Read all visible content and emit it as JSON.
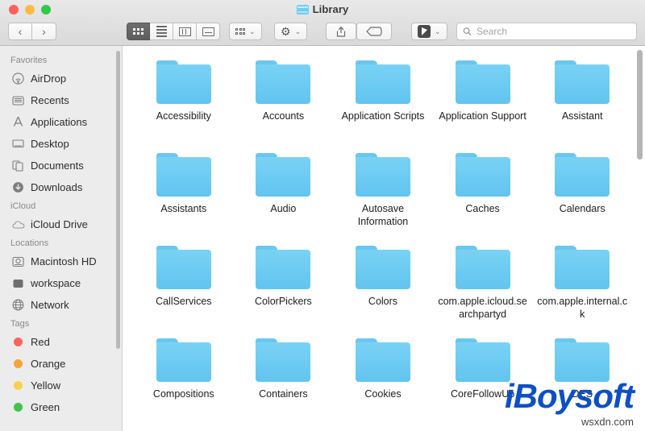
{
  "window": {
    "title": "Library",
    "traffic_lights": [
      {
        "name": "close",
        "color": "#fc615d"
      },
      {
        "name": "minimize",
        "color": "#fdbc40"
      },
      {
        "name": "maximize",
        "color": "#34c749"
      }
    ]
  },
  "toolbar": {
    "back_label": "‹",
    "forward_label": "›",
    "view_modes": [
      {
        "name": "icon-view",
        "active": true
      },
      {
        "name": "list-view",
        "active": false
      },
      {
        "name": "column-view",
        "active": false
      },
      {
        "name": "gallery-view",
        "active": false
      }
    ],
    "group_by_label": "",
    "action_label": "⚙",
    "share_label": "⇧",
    "tag_label": "▭",
    "chevron": "⌄"
  },
  "search": {
    "placeholder": "Search",
    "value": "",
    "icon": "search-icon"
  },
  "sidebar": {
    "sections": [
      {
        "header": "Favorites",
        "items": [
          {
            "label": "AirDrop",
            "icon": "airdrop-icon"
          },
          {
            "label": "Recents",
            "icon": "recents-icon"
          },
          {
            "label": "Applications",
            "icon": "applications-icon"
          },
          {
            "label": "Desktop",
            "icon": "desktop-icon"
          },
          {
            "label": "Documents",
            "icon": "documents-icon"
          },
          {
            "label": "Downloads",
            "icon": "downloads-icon"
          }
        ]
      },
      {
        "header": "iCloud",
        "items": [
          {
            "label": "iCloud Drive",
            "icon": "cloud-icon"
          }
        ]
      },
      {
        "header": "Locations",
        "items": [
          {
            "label": "Macintosh HD",
            "icon": "harddisk-icon"
          },
          {
            "label": "workspace",
            "icon": "volume-icon"
          },
          {
            "label": "Network",
            "icon": "globe-icon"
          }
        ]
      },
      {
        "header": "Tags",
        "items": [
          {
            "label": "Red",
            "icon": "tag-dot-icon",
            "color": "#f9655d"
          },
          {
            "label": "Orange",
            "icon": "tag-dot-icon",
            "color": "#f6a33a"
          },
          {
            "label": "Yellow",
            "icon": "tag-dot-icon",
            "color": "#f8d14c"
          },
          {
            "label": "Green",
            "icon": "tag-dot-icon",
            "color": "#3fc34a"
          }
        ]
      }
    ]
  },
  "content": {
    "items": [
      {
        "label": "Accessibility"
      },
      {
        "label": "Accounts"
      },
      {
        "label": "Application Scripts"
      },
      {
        "label": "Application Support"
      },
      {
        "label": "Assistant"
      },
      {
        "label": "Assistants"
      },
      {
        "label": "Audio"
      },
      {
        "label": "Autosave Information"
      },
      {
        "label": "Caches"
      },
      {
        "label": "Calendars"
      },
      {
        "label": "CallServices"
      },
      {
        "label": "ColorPickers"
      },
      {
        "label": "Colors"
      },
      {
        "label": "com.apple.icloud.searchpartyd"
      },
      {
        "label": "com.apple.internal.ck"
      },
      {
        "label": "Compositions"
      },
      {
        "label": "Containers"
      },
      {
        "label": "Cookies"
      },
      {
        "label": "CoreFollowUp"
      },
      {
        "label": "DES"
      }
    ]
  },
  "watermark": {
    "brand": "iBoysoft",
    "site": "wsxdn.com"
  }
}
